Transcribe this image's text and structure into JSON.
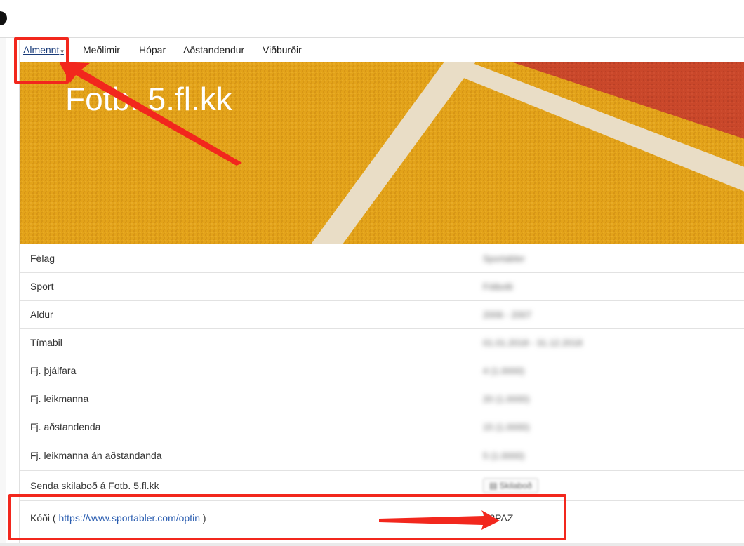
{
  "tabs": [
    {
      "label": "Almennt"
    },
    {
      "label": "Meðlimir"
    },
    {
      "label": "Hópar"
    },
    {
      "label": "Aðstandendur"
    },
    {
      "label": "Viðburðir"
    }
  ],
  "banner": {
    "title": "Fotb. 5.fl.kk"
  },
  "rows": [
    {
      "label": "Félag",
      "value": "Sportabler"
    },
    {
      "label": "Sport",
      "value": "Fótbolti"
    },
    {
      "label": "Aldur",
      "value": "2006 - 2007"
    },
    {
      "label": "Tímabil",
      "value": "01.01.2018 - 31.12.2018"
    },
    {
      "label": "Fj. þjálfara",
      "value": "4 (1.0000)"
    },
    {
      "label": "Fj. leikmanna",
      "value": "20 (1.0000)"
    },
    {
      "label": "Fj. aðstandenda",
      "value": "15 (1.0000)"
    },
    {
      "label": "Fj. leikmanna án aðstandanda",
      "value": "5 (1.0000)"
    }
  ],
  "message_row": {
    "label": "Senda skilaboð á Fotb. 5.fl.kk",
    "button": "Skilaboð"
  },
  "code_row": {
    "label_prefix": "Kóði (",
    "link": "https://www.sportabler.com/optin",
    "label_suffix": ")",
    "value": "Y3PAZ"
  },
  "colors": {
    "accent": "#f2271d",
    "link": "#2a5db0",
    "banner": "#e0a21a"
  }
}
